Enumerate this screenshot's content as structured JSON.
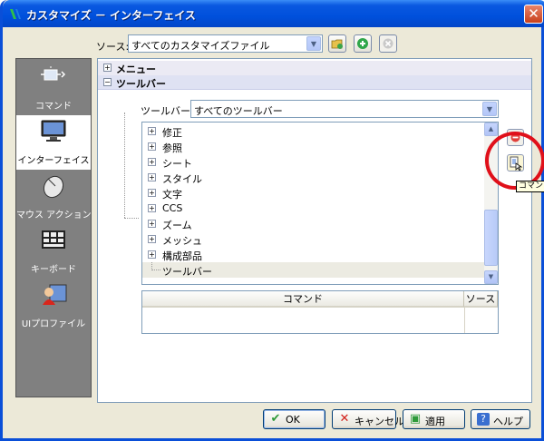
{
  "window": {
    "title": "カスタマイズ － インターフェイス",
    "close_label": "✕"
  },
  "source": {
    "label": "ソース:",
    "value": "すべてのカスタマイズファイル"
  },
  "sidebar": {
    "items": [
      {
        "label": "コマンド"
      },
      {
        "label": "インターフェイス"
      },
      {
        "label": "マウス アクション"
      },
      {
        "label": "キーボード"
      },
      {
        "label": "UIプロファイル"
      }
    ]
  },
  "groups": [
    {
      "expander": "+",
      "label": "メニュー"
    },
    {
      "expander": "−",
      "label": "ツールバー"
    }
  ],
  "toolbar_filter": {
    "label": "ツールバー:",
    "value": "すべてのツールバー"
  },
  "tree": {
    "items": [
      {
        "expander": "+",
        "label": "修正"
      },
      {
        "expander": "+",
        "label": "参照"
      },
      {
        "expander": "+",
        "label": "シート"
      },
      {
        "expander": "+",
        "label": "スタイル"
      },
      {
        "expander": "+",
        "label": "文字"
      },
      {
        "expander": "+",
        "label": "CCS"
      },
      {
        "expander": "+",
        "label": "ズーム"
      },
      {
        "expander": "+",
        "label": "メッシュ"
      },
      {
        "expander": "+",
        "label": "構成部品"
      },
      {
        "expander": "",
        "label": "ツールバー"
      }
    ]
  },
  "table": {
    "columns": [
      "コマンド",
      "ソース"
    ]
  },
  "tooltip": {
    "text": "コマンド"
  },
  "buttons": {
    "ok": "OK",
    "cancel": "キャンセル",
    "apply": "適用",
    "help": "ヘルプ"
  },
  "colors": {
    "title_bar": "#0050dc",
    "highlight_ring": "#e0101a",
    "sidebar_bg": "#808080"
  }
}
